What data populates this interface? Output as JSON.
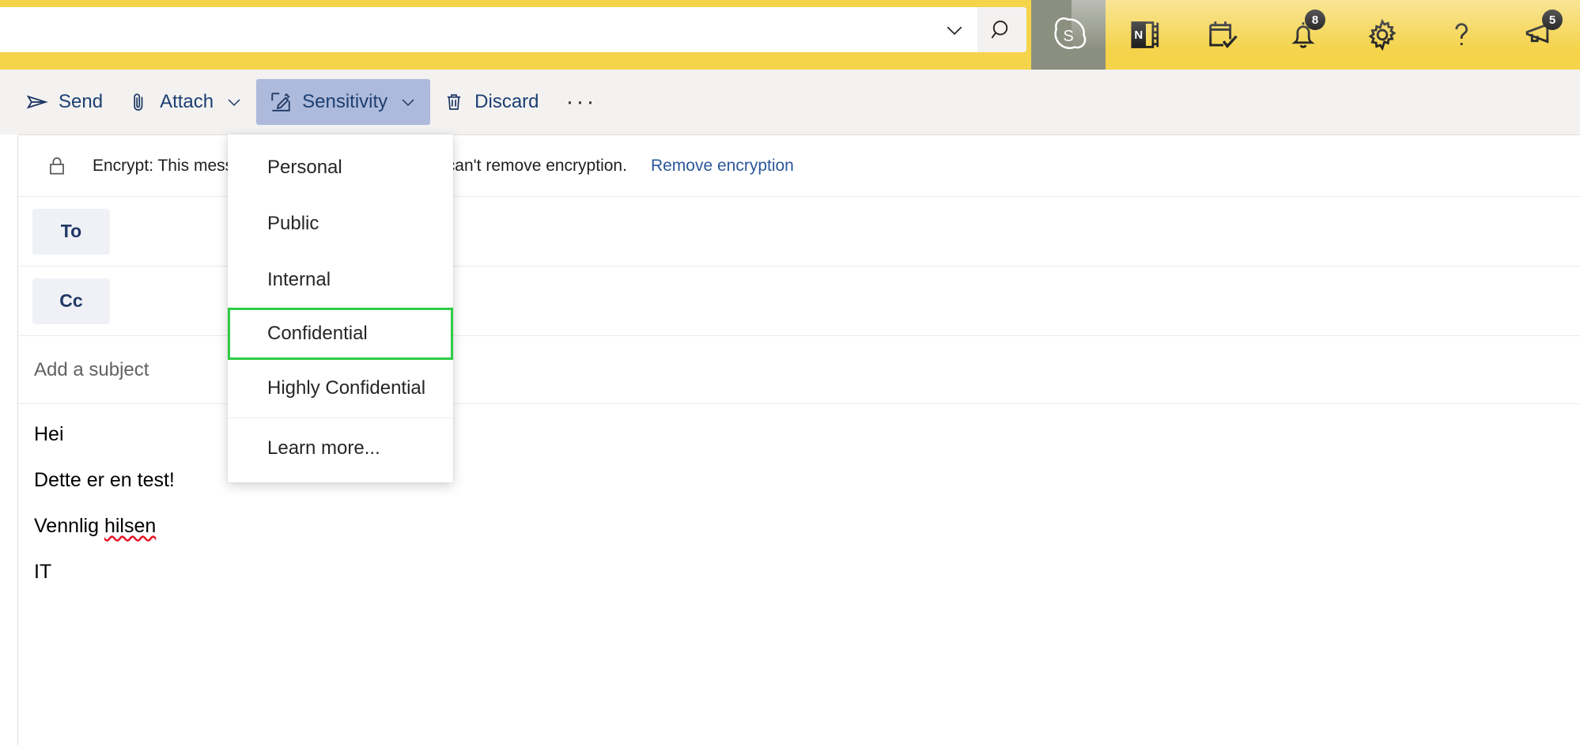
{
  "topbar": {
    "accent_color": "#f5d34b",
    "search": {
      "value": "",
      "placeholder": ""
    },
    "chevron_icon": "chevron-down-icon",
    "search_icon": "search-icon",
    "apps": [
      {
        "name": "skype-icon",
        "label": "Skype",
        "badge": ""
      },
      {
        "name": "onenote-icon",
        "label": "OneNote",
        "badge": ""
      },
      {
        "name": "tasks-calendar-icon",
        "label": "To Do",
        "badge": ""
      },
      {
        "name": "bell-icon",
        "label": "Notifications",
        "badge": "8"
      },
      {
        "name": "gear-icon",
        "label": "Settings",
        "badge": ""
      },
      {
        "name": "question-icon",
        "label": "Help",
        "badge": ""
      },
      {
        "name": "megaphone-icon",
        "label": "Feedback",
        "badge": "5"
      }
    ]
  },
  "toolbar": {
    "send_label": "Send",
    "attach_label": "Attach",
    "sensitivity_label": "Sensitivity",
    "discard_label": "Discard",
    "overflow_label": "···",
    "active_button": "Sensitivity",
    "active_bg": "#aebadb",
    "text_color": "#1f3864"
  },
  "sensitivity_menu": {
    "items": [
      {
        "label": "Personal",
        "selected": false
      },
      {
        "label": "Public",
        "selected": false
      },
      {
        "label": "Internal",
        "selected": false
      },
      {
        "label": "Confidential",
        "selected": true
      },
      {
        "label": "Highly Confidential",
        "selected": false
      }
    ],
    "footer_label": "Learn more...",
    "selection_outline_color": "#2ecc44"
  },
  "compose": {
    "encrypt_banner": {
      "icon": "lock-icon",
      "text": "Encrypt: This message is encrypted. Recipients can't remove encryption.",
      "link_label": "Remove encryption",
      "link_color": "#2b579a"
    },
    "to_field": {
      "chip_label": "To",
      "value": "",
      "placeholder": ""
    },
    "cc_field": {
      "chip_label": "Cc",
      "value": "",
      "placeholder": ""
    },
    "subject_field": {
      "value": "",
      "placeholder": "Add a subject"
    },
    "body_lines": [
      {
        "text": "Hei",
        "misspelled": ""
      },
      {
        "text": "Dette er en test!",
        "misspelled": ""
      },
      {
        "text": "Vennlig ",
        "misspelled": "hilsen"
      },
      {
        "text": "IT",
        "misspelled": ""
      }
    ]
  }
}
